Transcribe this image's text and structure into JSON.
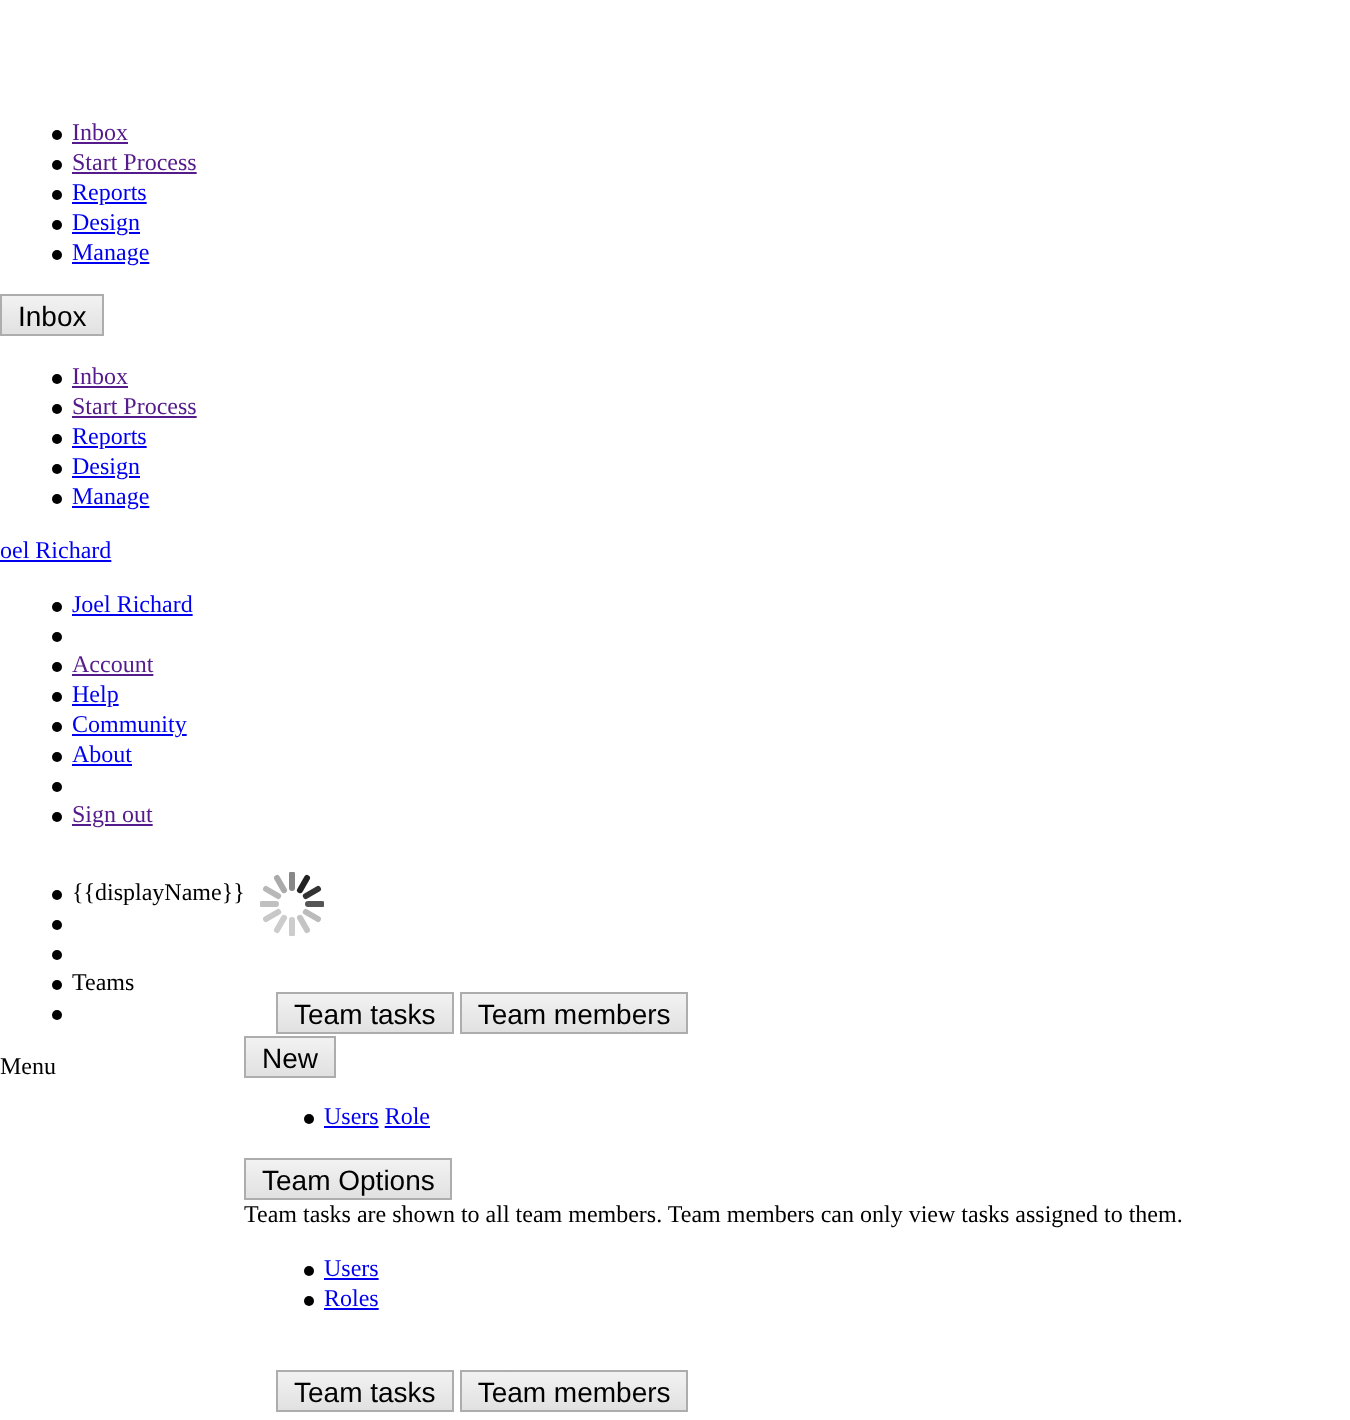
{
  "nav_menu": [
    {
      "label": "Inbox",
      "visited": true
    },
    {
      "label": "Start Process",
      "visited": true
    },
    {
      "label": "Reports",
      "visited": false
    },
    {
      "label": "Design",
      "visited": false
    },
    {
      "label": "Manage",
      "visited": false
    }
  ],
  "inbox_button": "Inbox",
  "nav_menu_2": [
    {
      "label": "Inbox",
      "visited": true
    },
    {
      "label": "Start Process",
      "visited": true
    },
    {
      "label": "Reports",
      "visited": false
    },
    {
      "label": "Design",
      "visited": false
    },
    {
      "label": "Manage",
      "visited": false
    }
  ],
  "user_link": {
    "label": "oel Richard",
    "visited": false
  },
  "user_menu": [
    {
      "kind": "link",
      "label": "Joel Richard",
      "visited": false
    },
    {
      "kind": "empty"
    },
    {
      "kind": "link",
      "label": "Account",
      "visited": true
    },
    {
      "kind": "link",
      "label": "Help",
      "visited": false
    },
    {
      "kind": "link",
      "label": "Community",
      "visited": false
    },
    {
      "kind": "link",
      "label": "About",
      "visited": false
    },
    {
      "kind": "empty"
    },
    {
      "kind": "link",
      "label": "Sign out",
      "visited": true
    }
  ],
  "side_menu": [
    {
      "kind": "text",
      "label": "{{displayName}}"
    },
    {
      "kind": "empty"
    },
    {
      "kind": "empty"
    },
    {
      "kind": "text",
      "label": "Teams"
    },
    {
      "kind": "empty"
    }
  ],
  "menu_label": "Menu",
  "team_tabs": [
    "Team tasks",
    "Team members"
  ],
  "new_button": "New",
  "team_links": [
    {
      "label": "Users",
      "visited": false
    },
    {
      "label": "Role",
      "visited": false
    }
  ],
  "options_button": "Team Options",
  "description": "Team tasks are shown to all team members. Team members can only view tasks assigned to them.",
  "admin_links": [
    {
      "label": "Users",
      "visited": false
    },
    {
      "label": "Roles",
      "visited": false
    }
  ],
  "team_tabs_bottom": [
    "Team tasks",
    "Team members"
  ]
}
